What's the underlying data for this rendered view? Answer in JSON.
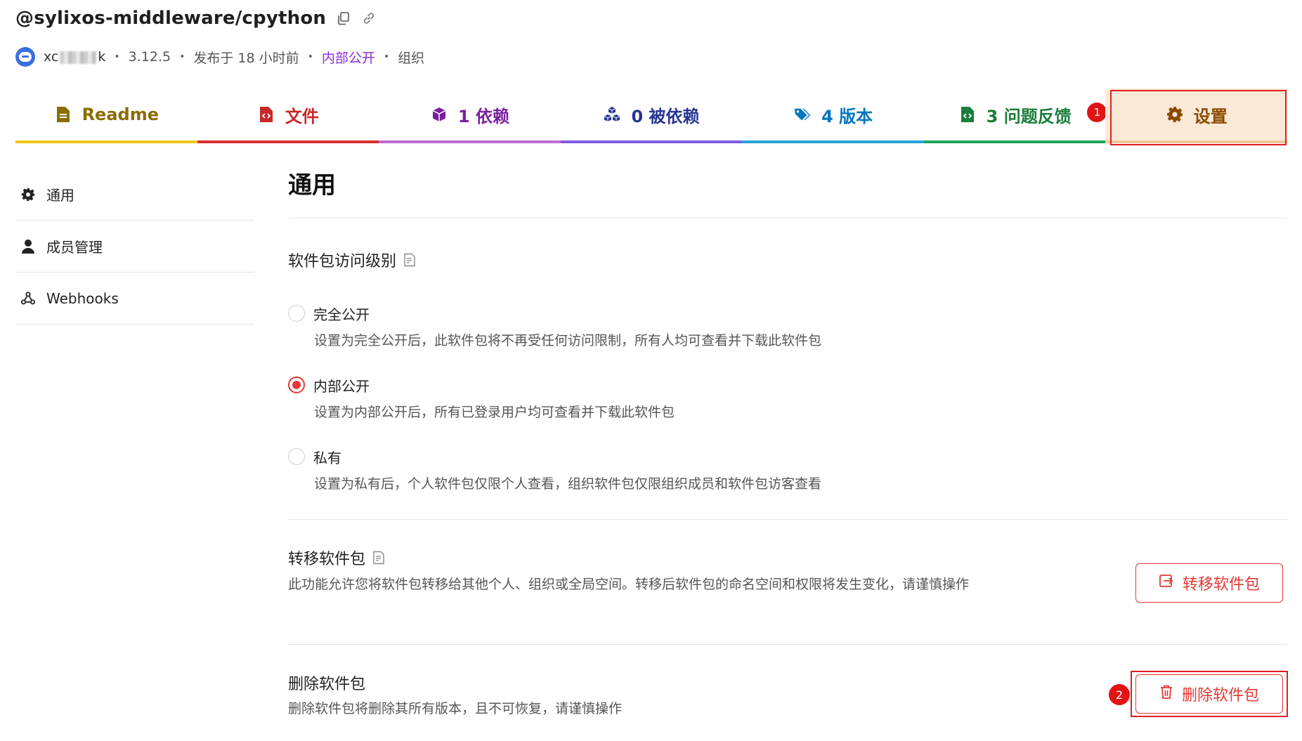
{
  "header": {
    "package_name": "@sylixos-middleware/cpython",
    "user_prefix": "xc",
    "user_suffix": "k",
    "version": "3.12.5",
    "published": "发布于 18 小时前",
    "visibility": "内部公开",
    "owner_type": "组织",
    "separator": "•"
  },
  "tabs": [
    {
      "label": "Readme",
      "icon": "readme-file-icon",
      "color": "#f0c419"
    },
    {
      "label": "文件",
      "icon": "code-file-icon",
      "color": "#d32f2f"
    },
    {
      "label": "1 依赖",
      "icon": "cube-icon",
      "color": "#c06ad6"
    },
    {
      "label": "0 被依赖",
      "icon": "cubes-icon",
      "color": "#7f5be0"
    },
    {
      "label": "4 版本",
      "icon": "tags-icon",
      "color": "#29a3d6"
    },
    {
      "label": "3 问题反馈",
      "icon": "issue-file-icon",
      "color": "#1fa35a"
    },
    {
      "label": "设置",
      "icon": "gear-icon",
      "color": "#f2c79a",
      "active": true
    }
  ],
  "annotations": {
    "badge_1": "1",
    "badge_2": "2",
    "highlight_color": "#e02020"
  },
  "sidebar": {
    "items": [
      {
        "label": "通用",
        "icon": "gear-icon"
      },
      {
        "label": "成员管理",
        "icon": "user-icon"
      },
      {
        "label": "Webhooks",
        "icon": "webhook-icon"
      }
    ]
  },
  "main": {
    "title": "通用",
    "access": {
      "heading": "软件包访问级别",
      "options": [
        {
          "label": "完全公开",
          "desc": "设置为完全公开后，此软件包将不再受任何访问限制，所有人均可查看并下载此软件包",
          "checked": false
        },
        {
          "label": "内部公开",
          "desc": "设置为内部公开后，所有已登录用户均可查看并下载此软件包",
          "checked": true
        },
        {
          "label": "私有",
          "desc": "设置为私有后，个人软件包仅限个人查看，组织软件包仅限组织成员和软件包访客查看",
          "checked": false
        }
      ]
    },
    "transfer": {
      "heading": "转移软件包",
      "desc": "此功能允许您将软件包转移给其他个人、组织或全局空间。转移后软件包的命名空间和权限将发生变化，请谨慎操作",
      "button": "转移软件包"
    },
    "delete": {
      "heading": "删除软件包",
      "desc": "删除软件包将删除其所有版本，且不可恢复，请谨慎操作",
      "button": "删除软件包"
    }
  },
  "colors": {
    "accent_red": "#e53935",
    "visibility_purple": "#8a2be2"
  }
}
